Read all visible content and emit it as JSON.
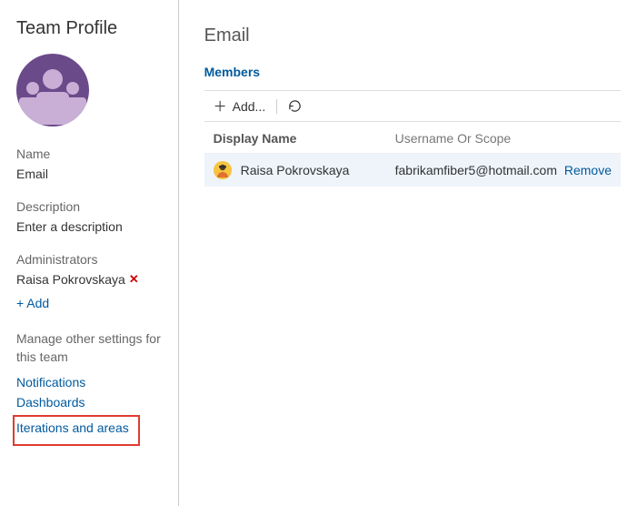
{
  "sidebar": {
    "title": "Team Profile",
    "name_label": "Name",
    "name_value": "Email",
    "description_label": "Description",
    "description_value": "Enter a description",
    "admins_label": "Administrators",
    "admins": [
      {
        "display": "Raisa Pokrovskaya"
      }
    ],
    "add_label": "+ Add",
    "settings_label": "Manage other settings for this team",
    "links": {
      "notifications": "Notifications",
      "dashboards": "Dashboards",
      "iterations": "Iterations and areas"
    }
  },
  "main": {
    "title": "Email",
    "members_heading": "Members",
    "toolbar": {
      "add_label": "Add..."
    },
    "table": {
      "col_name": "Display Name",
      "col_user": "Username Or Scope",
      "rows": [
        {
          "name": "Raisa Pokrovskaya",
          "user": "fabrikamfiber5@hotmail.com",
          "action": "Remove"
        }
      ]
    }
  }
}
